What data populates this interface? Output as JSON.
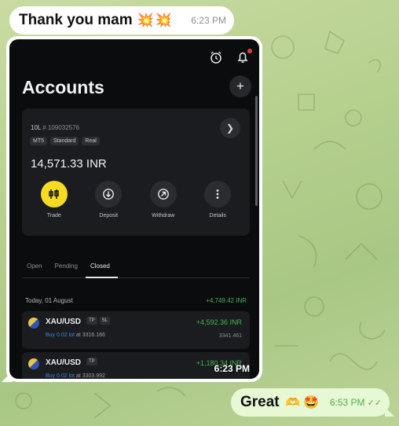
{
  "chat": {
    "incoming_text": "Thank you mam",
    "incoming_emoji": "💥💥",
    "incoming_time": "6:23 PM",
    "image_time": "6:23 PM",
    "outgoing_text": "Great",
    "outgoing_emoji_1": "🫶",
    "outgoing_emoji_2": "🤩",
    "outgoing_time": "6:53 PM",
    "outgoing_ticks": "✓✓",
    "outgoing_status": "read"
  },
  "app": {
    "title": "Accounts",
    "add_label": "+",
    "account": {
      "type_label": "10L",
      "id": "# 109032576",
      "tags": [
        "MT5",
        "Standard",
        "Real"
      ],
      "balance": "14,571.33 INR",
      "actions": [
        {
          "label": "Trade",
          "icon": "trade-icon"
        },
        {
          "label": "Deposit",
          "icon": "deposit-icon"
        },
        {
          "label": "Withdraw",
          "icon": "withdraw-icon"
        },
        {
          "label": "Details",
          "icon": "more-icon"
        }
      ]
    },
    "tabs": [
      {
        "label": "Open",
        "active": false
      },
      {
        "label": "Pending",
        "active": false
      },
      {
        "label": "Closed",
        "active": true
      }
    ],
    "day": {
      "label": "Today, 01 August",
      "profit": "+4,749.42 INR"
    },
    "trades": [
      {
        "symbol": "XAU/USD",
        "badges": [
          "TP",
          "SL"
        ],
        "buy": "Buy 0.02 lot",
        "at": "at 3316.166",
        "pnl": "+4,592.36 INR",
        "price": "3341.461"
      },
      {
        "symbol": "XAU/USD",
        "badges": [
          "TP"
        ],
        "buy": "Buy 0.02 lot",
        "at": "at 3303.992",
        "pnl": "+1,180.34 INR",
        "price": ""
      }
    ]
  },
  "colors": {
    "accent_yellow": "#f5dc22",
    "profit_green": "#3fb950",
    "link_blue": "#3d86d6",
    "outgoing_bubble": "#e7f9d4"
  }
}
